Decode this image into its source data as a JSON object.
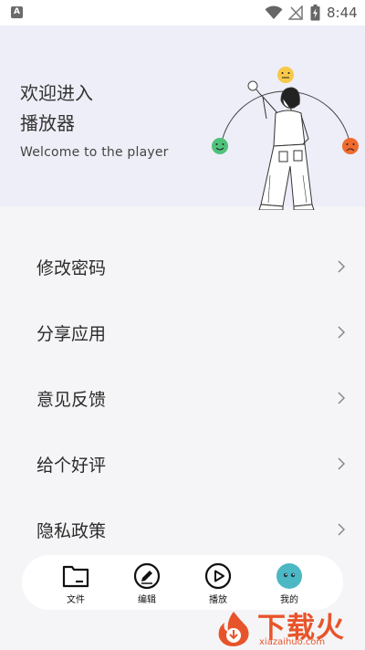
{
  "status_bar": {
    "notification_icon": "A",
    "time": "8:44",
    "icons": [
      "wifi-icon",
      "signal-icon",
      "battery-charging-icon"
    ]
  },
  "hero": {
    "title_line1": "欢迎进入",
    "title_line2": "播放器",
    "subtitle": "Welcome to the player",
    "illustration": "person-with-mood-faces-illustration",
    "colors": {
      "background": "#eeeef8",
      "happy": "#4fc27a",
      "neutral": "#f7c948",
      "sad": "#ef6b2f"
    }
  },
  "menu": {
    "items": [
      {
        "label": "修改密码",
        "icon": "chevron-right-icon"
      },
      {
        "label": "分享应用",
        "icon": "chevron-right-icon"
      },
      {
        "label": "意见反馈",
        "icon": "chevron-right-icon"
      },
      {
        "label": "给个好评",
        "icon": "chevron-right-icon"
      },
      {
        "label": "隐私政策",
        "icon": "chevron-right-icon"
      }
    ]
  },
  "tab_bar": {
    "tabs": [
      {
        "label": "文件",
        "icon": "folder-icon"
      },
      {
        "label": "编辑",
        "icon": "pencil-icon"
      },
      {
        "label": "播放",
        "icon": "play-icon"
      },
      {
        "label": "我的",
        "icon": "profile-avatar-icon",
        "active": true
      }
    ],
    "accent": "#4bb8c4"
  },
  "watermark": {
    "title": "下载火",
    "domain": "xiazaihuo.com",
    "color": "#e8542a"
  }
}
